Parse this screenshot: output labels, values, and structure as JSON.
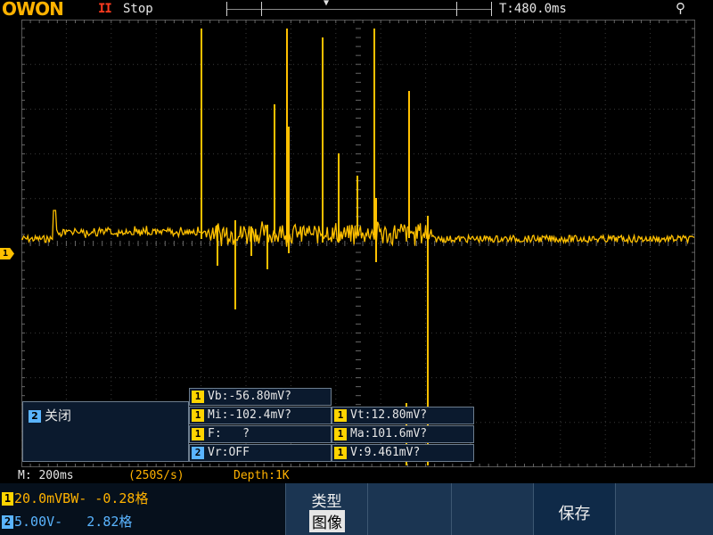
{
  "header": {
    "logo": "OWON",
    "run_icon": "II",
    "run_status": "Stop",
    "trigger_marker": "▼",
    "time_position": "T:480.0ms",
    "usb_icon": "usb-icon"
  },
  "ch1_marker": "1",
  "ch2_panel": {
    "channel": "2",
    "label": "关闭"
  },
  "measurements": [
    {
      "channel": "1",
      "text": "Vb:-56.80mV?"
    },
    {
      "channel": "1",
      "text": "Mi:-102.4mV?"
    },
    {
      "channel": "1",
      "text": "Vt:12.80mV?"
    },
    {
      "channel": "1",
      "text": "F:   ?"
    },
    {
      "channel": "1",
      "text": "Ma:101.6mV?"
    },
    {
      "channel": "2",
      "text": "Vr:OFF"
    },
    {
      "channel": "1",
      "text": "V:9.461mV?"
    }
  ],
  "status": {
    "timebase": "M: 200ms",
    "sample_rate": "(250S/s)",
    "depth": "Depth:1K"
  },
  "channels": [
    {
      "num": "1",
      "text": "20.0mVBW- -0.28格",
      "color": "#ffb200"
    },
    {
      "num": "2",
      "text": "5.00V-   2.82格",
      "color": "#5ab4ff"
    }
  ],
  "softkeys": {
    "type_title": "类型",
    "type_value": "图像",
    "save": "保存"
  },
  "colors": {
    "ch1": "#ffc000",
    "ch2": "#5ab4ff",
    "grid": "#3a3a3a"
  }
}
